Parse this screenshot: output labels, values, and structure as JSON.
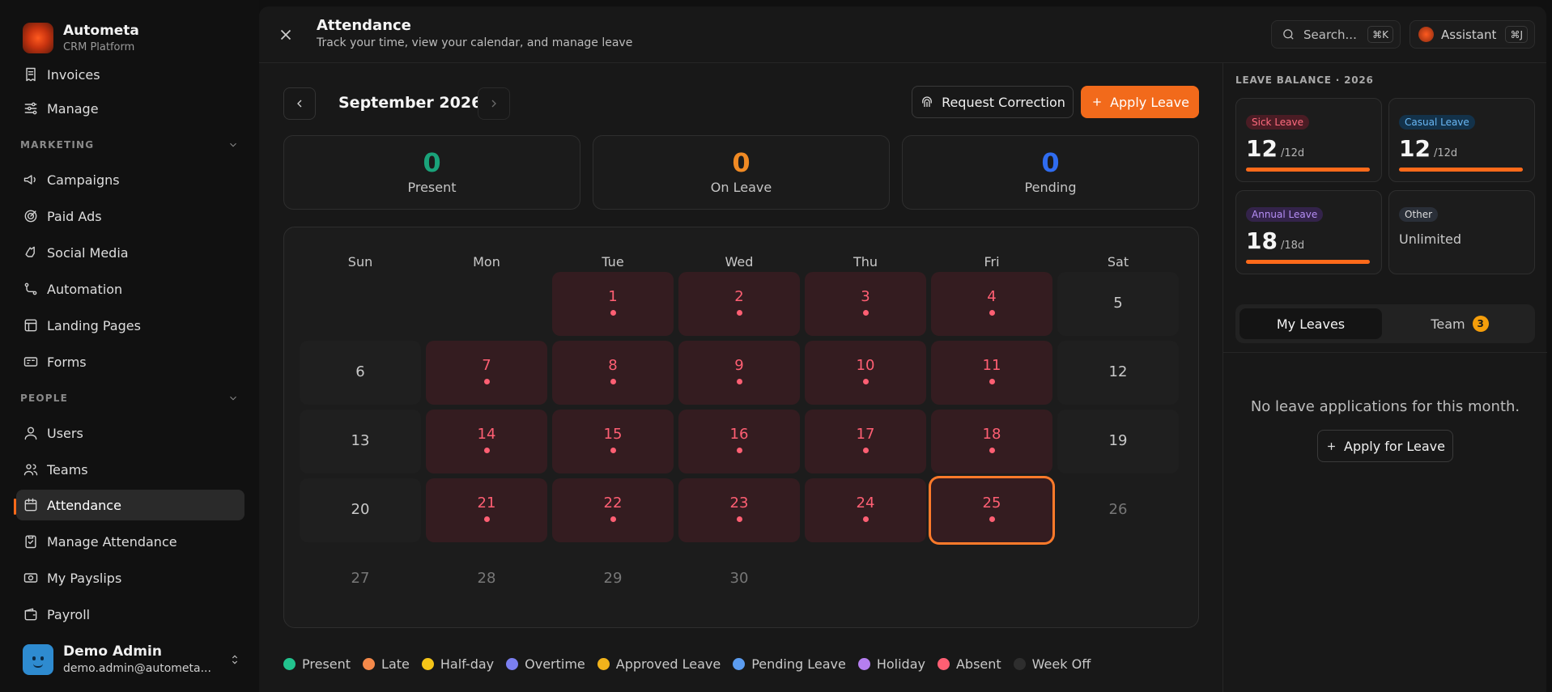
{
  "brand": {
    "name": "Autometa",
    "subtitle": "CRM Platform"
  },
  "sidebar": {
    "items_top": [
      {
        "label": "Invoices",
        "icon": "invoice-icon"
      },
      {
        "label": "Manage",
        "icon": "sliders-icon"
      }
    ],
    "marketing_label": "MARKETING",
    "marketing": [
      {
        "label": "Campaigns",
        "icon": "megaphone-icon"
      },
      {
        "label": "Paid Ads",
        "icon": "target-icon"
      },
      {
        "label": "Social Media",
        "icon": "social-icon"
      },
      {
        "label": "Automation",
        "icon": "workflow-icon"
      },
      {
        "label": "Landing Pages",
        "icon": "layout-icon"
      },
      {
        "label": "Forms",
        "icon": "form-icon"
      }
    ],
    "people_label": "PEOPLE",
    "people": [
      {
        "label": "Users",
        "icon": "user-icon"
      },
      {
        "label": "Teams",
        "icon": "users-icon"
      },
      {
        "label": "Attendance",
        "icon": "calendar-icon",
        "active": true
      },
      {
        "label": "Manage Attendance",
        "icon": "clipboard-icon"
      },
      {
        "label": "My Payslips",
        "icon": "payslip-icon"
      },
      {
        "label": "Payroll",
        "icon": "wallet-icon"
      }
    ]
  },
  "user": {
    "name": "Demo Admin",
    "email": "demo.admin@autometa..."
  },
  "topbar": {
    "title": "Attendance",
    "subtitle": "Track your time, view your calendar, and manage leave",
    "search_placeholder": "Search...",
    "search_shortcut": "⌘K",
    "assistant_label": "Assistant",
    "assistant_shortcut": "⌘J"
  },
  "calendar": {
    "month_label": "September 2026",
    "request_correction": "Request Correction",
    "apply_leave": "Apply Leave",
    "stats": [
      {
        "value": "0",
        "label": "Present",
        "color": "#1aa37a"
      },
      {
        "value": "0",
        "label": "On Leave",
        "color": "#f08a24"
      },
      {
        "value": "0",
        "label": "Pending",
        "color": "#2f6cf0"
      }
    ],
    "weekdays": [
      "Sun",
      "Mon",
      "Tue",
      "Wed",
      "Thu",
      "Fri",
      "Sat"
    ],
    "first_weekday_index": 2,
    "days_in_month": 30,
    "today": 25,
    "status_by_day": {
      "1": "absent",
      "2": "absent",
      "3": "absent",
      "4": "absent",
      "5": "weekoff",
      "6": "weekoff",
      "7": "absent",
      "8": "absent",
      "9": "absent",
      "10": "absent",
      "11": "absent",
      "12": "weekoff",
      "13": "weekoff",
      "14": "absent",
      "15": "absent",
      "16": "absent",
      "17": "absent",
      "18": "absent",
      "19": "weekoff",
      "20": "weekoff",
      "21": "absent",
      "22": "absent",
      "23": "absent",
      "24": "absent",
      "25": "absent",
      "26": "future",
      "27": "future",
      "28": "future",
      "29": "future",
      "30": "future"
    }
  },
  "legend": [
    {
      "label": "Present",
      "color": "#22c38e"
    },
    {
      "label": "Late",
      "color": "#f4894a"
    },
    {
      "label": "Half-day",
      "color": "#f5c518"
    },
    {
      "label": "Overtime",
      "color": "#7b7ff0"
    },
    {
      "label": "Approved Leave",
      "color": "#f2b31b"
    },
    {
      "label": "Pending Leave",
      "color": "#5b9cf0"
    },
    {
      "label": "Holiday",
      "color": "#b57ef0"
    },
    {
      "label": "Absent",
      "color": "#ff5f73"
    },
    {
      "label": "Week Off",
      "color": "#2e2e2e"
    }
  ],
  "leave_balance": {
    "title": "LEAVE BALANCE · 2026",
    "cards": [
      {
        "label": "Sick Leave",
        "value": "12",
        "of": "/12d",
        "remaining_fraction": 1.0,
        "badge_bg": "#4a1c24",
        "badge_fg": "#ff6b7e"
      },
      {
        "label": "Casual Leave",
        "value": "12",
        "of": "/12d",
        "remaining_fraction": 1.0,
        "badge_bg": "#13324a",
        "badge_fg": "#6ab8f5"
      },
      {
        "label": "Annual Leave",
        "value": "18",
        "of": "/18d",
        "remaining_fraction": 1.0,
        "badge_bg": "#33234a",
        "badge_fg": "#b58ef5"
      },
      {
        "label": "Other",
        "note": "Unlimited",
        "badge_bg": "#2a2f38",
        "badge_fg": "#dcdcdc"
      }
    ]
  },
  "tabs": {
    "my_leaves": "My Leaves",
    "team": "Team",
    "team_count": "3"
  },
  "empty_state": {
    "message": "No leave applications for this month.",
    "button": "Apply for Leave"
  }
}
